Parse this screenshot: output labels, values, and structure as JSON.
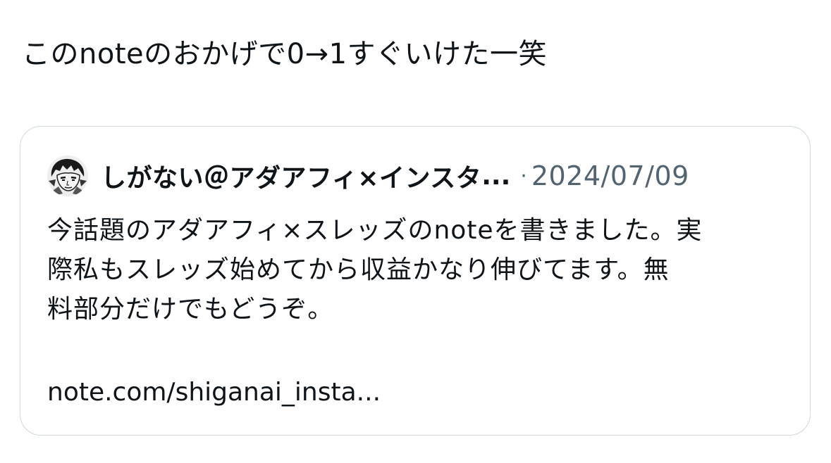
{
  "tweet": {
    "text": "このnoteのおかげで0→1すぐいけた一笑"
  },
  "quoted_post": {
    "author_name": "しがない＠アダアフィ×インスタ",
    "truncation": "...",
    "separator": "·",
    "date": "2024/07/09",
    "body_lines": [
      "今話題のアダアフィ×スレッズのnoteを書きました。実",
      "際私もスレッズ始めてから収益かなり伸びてます。無",
      "料部分だけでもどうぞ。"
    ],
    "link": "note.com/shiganai_insta..."
  }
}
